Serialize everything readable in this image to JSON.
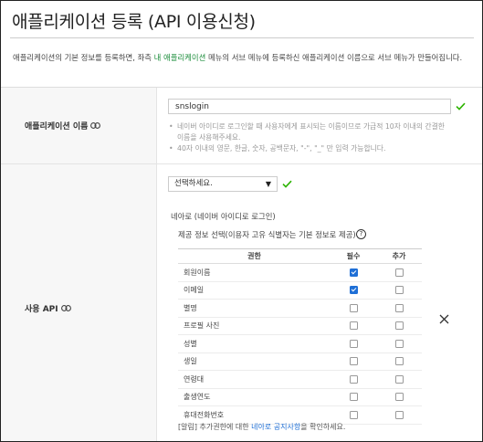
{
  "title": "애플리케이션 등록 (API 이용신청)",
  "description": {
    "before_link": "애플리케이션의 기본 정보를 등록하면, 좌측 ",
    "link": "내 애플리케이션",
    "after_link": " 메뉴의 서브 메뉴에 등록하신 애플리케이션 이름으로 서브 메뉴가 만들어집니다."
  },
  "app_name_row": {
    "label": "애플리케이션 이름",
    "value": "snslogin",
    "hints": [
      "네이버 아이디로 로그인할 때 사용자에게 표시되는 이름이므로 가급적 10자 이내의 간결한 이름을 사용해주세요.",
      "40자 이내의 영문, 한글, 숫자, 공백문자, \"-\", \"_\" 만 입력 가능합니다."
    ]
  },
  "api_row": {
    "label": "사용 API",
    "select_value": "선택하세요.",
    "api_name": "네아로 (네이버 아이디로 로그인)",
    "provision_title": "제공 정보 선택(이용자 고유 식별자는 기본 정보로 제공)",
    "help_glyph": "?",
    "columns": [
      "권한",
      "필수",
      "추가"
    ],
    "permissions": [
      {
        "name": "회원이름",
        "required": true,
        "optional": false
      },
      {
        "name": "이메일",
        "required": true,
        "optional": false
      },
      {
        "name": "별명",
        "required": false,
        "optional": false
      },
      {
        "name": "프로필 사진",
        "required": false,
        "optional": false
      },
      {
        "name": "성별",
        "required": false,
        "optional": false
      },
      {
        "name": "생일",
        "required": false,
        "optional": false
      },
      {
        "name": "연령대",
        "required": false,
        "optional": false
      },
      {
        "name": "출생연도",
        "required": false,
        "optional": false
      },
      {
        "name": "휴대전화번호",
        "required": false,
        "optional": false
      }
    ],
    "notice": {
      "before": "[알림] 추가권한에 대한 ",
      "link": "네아로 공지사항",
      "after": "을 확인하세요."
    }
  },
  "colors": {
    "link_green": "#1a8c3a",
    "link_blue": "#1f6fd6",
    "check_green": "#2db400",
    "checkbox_checked": "#1f6fd6"
  },
  "icons": [
    "link-chain-icon",
    "check-icon",
    "chevron-down-icon",
    "help-icon",
    "close-icon"
  ]
}
